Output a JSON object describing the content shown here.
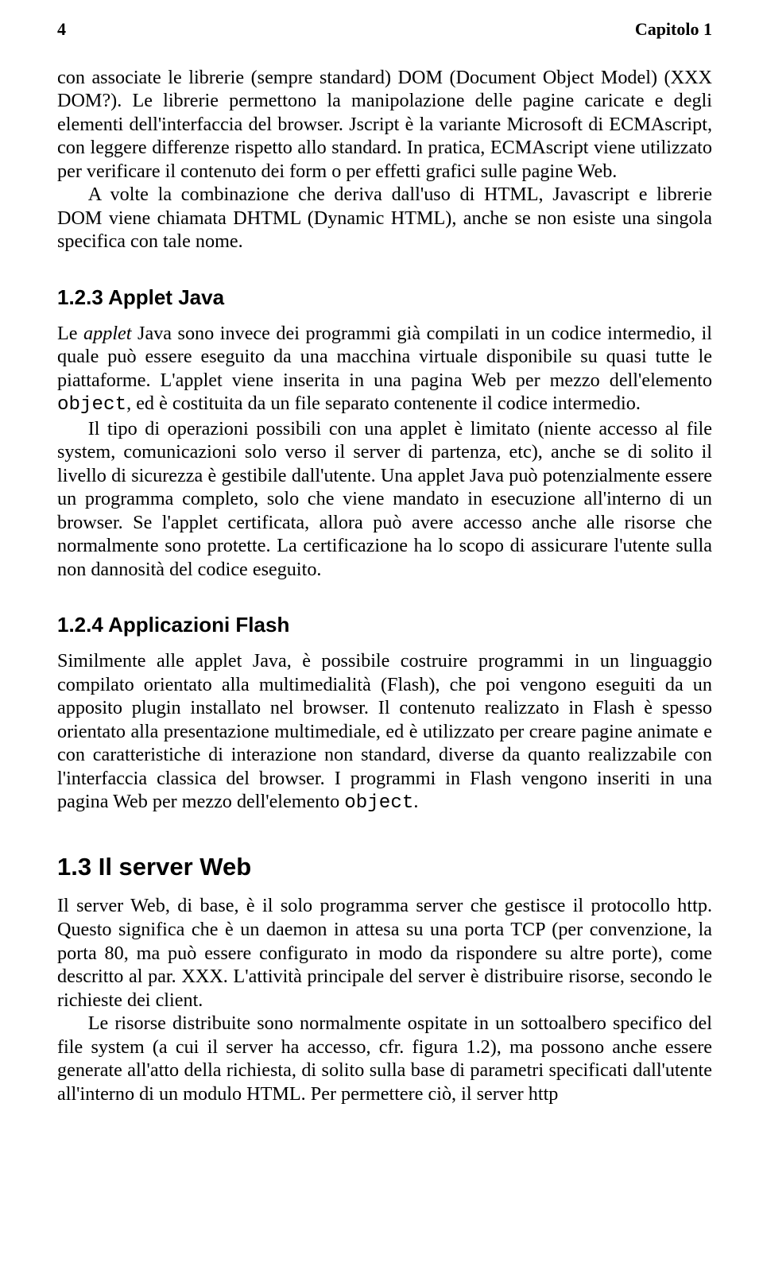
{
  "runhead": {
    "page_number": "4",
    "chapter": "Capitolo 1"
  },
  "para": {
    "intro1": "con associate le librerie (sempre standard) DOM (Document Object Model) (XXX DOM?). Le librerie permettono la manipolazione delle pagine caricate e degli elementi dell'interfaccia del browser. Jscript è la variante Microsoft di ECMA­script, con leggere differenze rispetto allo standard. In pratica, ECMAscript viene utilizzato per verificare il contenuto dei form o per effetti grafici sulle pagine Web.",
    "intro2": "A volte la combinazione che deriva dall'uso di HTML, Javascript e librerie DOM viene chiamata DHTML (Dynamic HTML), anche se non esiste una singola specifica con tale nome.",
    "applet_h": "1.2.3  Applet Java",
    "applet1_a": "Le ",
    "applet1_b": "applet",
    "applet1_c": " Java sono invece dei programmi già compilati in un codice intermedio, il quale può essere eseguito da una macchina virtuale disponibile su quasi tutte le piattaforme. L'applet viene inserita in una pagina Web per mezzo dell'elemento ",
    "applet1_code": "object",
    "applet1_d": ", ed è costituita da un file separato contenente il codice intermedio.",
    "applet2": "Il tipo di operazioni possibili con una applet è limitato (niente accesso al file system, comunicazioni solo verso il server di partenza, etc), anche se di solito il livello di sicurezza è gestibile dall'utente. Una applet Java può potenzialmente essere un programma completo, solo che viene mandato in esecuzione all'interno di un browser. Se l'applet certificata, allora può avere accesso anche alle risorse che normalmente sono protette. La certificazione ha lo scopo di assicurare l'utente sulla non dannosità del codice eseguito.",
    "flash_h": "1.2.4  Applicazioni Flash",
    "flash1_a": "Similmente alle applet Java, è possibile costruire programmi in un linguaggio compilato orientato alla multimedialità (Flash), che poi vengono eseguiti da un apposito plugin installato nel browser. Il contenuto realizzato in Flash è spesso orientato alla presentazione multimediale, ed è utilizzato per creare pagine anima­te e con caratteristiche di interazione non standard, diverse da quanto realizzabile con l'interfaccia classica del browser. I programmi in Flash vengono inseriti in una pagina Web per mezzo dell'elemento ",
    "flash1_code": "object",
    "flash1_b": ".",
    "server_h": "1.3  Il server Web",
    "server1": "Il server Web, di base, è il solo programma server che gestisce il protocollo http. Questo significa che è un daemon in attesa su una porta TCP (per convenzione, la porta 80, ma può essere configurato in modo da rispondere su altre porte), come descritto al par. XXX. L'attività principale del server è distribuire risorse, secondo le richieste dei client.",
    "server2": "Le risorse distribuite sono normalmente ospitate in un sottoalbero specifico del file system (a cui il server ha accesso, cfr. figura 1.2), ma possono anche essere generate all'atto della richiesta, di solito sulla base di parametri specifica­ti dall'utente all'interno di un modulo HTML. Per permettere ciò, il server http"
  }
}
